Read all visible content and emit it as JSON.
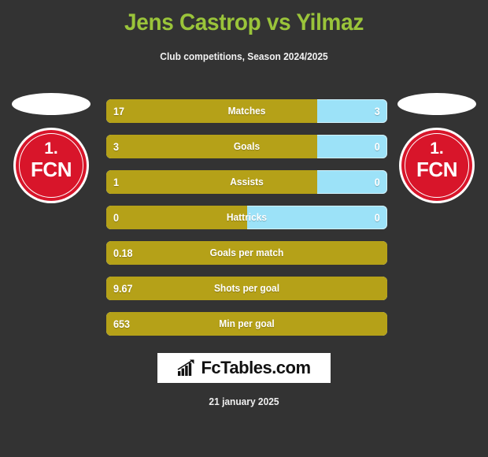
{
  "header": {
    "title": "Jens Castrop vs Yilmaz",
    "subtitle": "Club competitions, Season 2024/2025",
    "title_color": "#9ac43a"
  },
  "teams": {
    "left": {
      "crest_top": "1.",
      "crest_main": "FCN"
    },
    "right": {
      "crest_top": "1.",
      "crest_main": "FCN"
    }
  },
  "colors": {
    "background": "#333333",
    "left_bar": "#b5a118",
    "right_bar": "#9ce2f8",
    "accent_title": "#9ac43a"
  },
  "footer": {
    "brand": "FcTables.com",
    "brand_icon": "bar-chart-trend-icon",
    "date": "21 january 2025"
  },
  "chart_data": {
    "type": "bar",
    "title": "Jens Castrop vs Yilmaz",
    "subtitle": "Club competitions, Season 2024/2025",
    "orientation": "horizontal-diverging",
    "legend": [
      "Jens Castrop",
      "Yilmaz"
    ],
    "categories": [
      "Matches",
      "Goals",
      "Assists",
      "Hattricks",
      "Goals per match",
      "Shots per goal",
      "Min per goal"
    ],
    "series": [
      {
        "name": "Jens Castrop",
        "color": "#b5a118",
        "values": [
          "17",
          "3",
          "1",
          "0",
          "0.18",
          "9.67",
          "653"
        ]
      },
      {
        "name": "Yilmaz",
        "color": "#9ce2f8",
        "values": [
          "3",
          "0",
          "0",
          "0",
          "",
          "",
          ""
        ]
      }
    ],
    "rows": [
      {
        "label": "Matches",
        "left": "17",
        "right": "3",
        "left_pct": 75,
        "has_right": true
      },
      {
        "label": "Goals",
        "left": "3",
        "right": "0",
        "left_pct": 75,
        "has_right": true
      },
      {
        "label": "Assists",
        "left": "1",
        "right": "0",
        "left_pct": 75,
        "has_right": true
      },
      {
        "label": "Hattricks",
        "left": "0",
        "right": "0",
        "left_pct": 50,
        "has_right": true
      },
      {
        "label": "Goals per match",
        "left": "0.18",
        "right": "",
        "left_pct": 100,
        "has_right": false
      },
      {
        "label": "Shots per goal",
        "left": "9.67",
        "right": "",
        "left_pct": 100,
        "has_right": false
      },
      {
        "label": "Min per goal",
        "left": "653",
        "right": "",
        "left_pct": 100,
        "has_right": false
      }
    ]
  }
}
